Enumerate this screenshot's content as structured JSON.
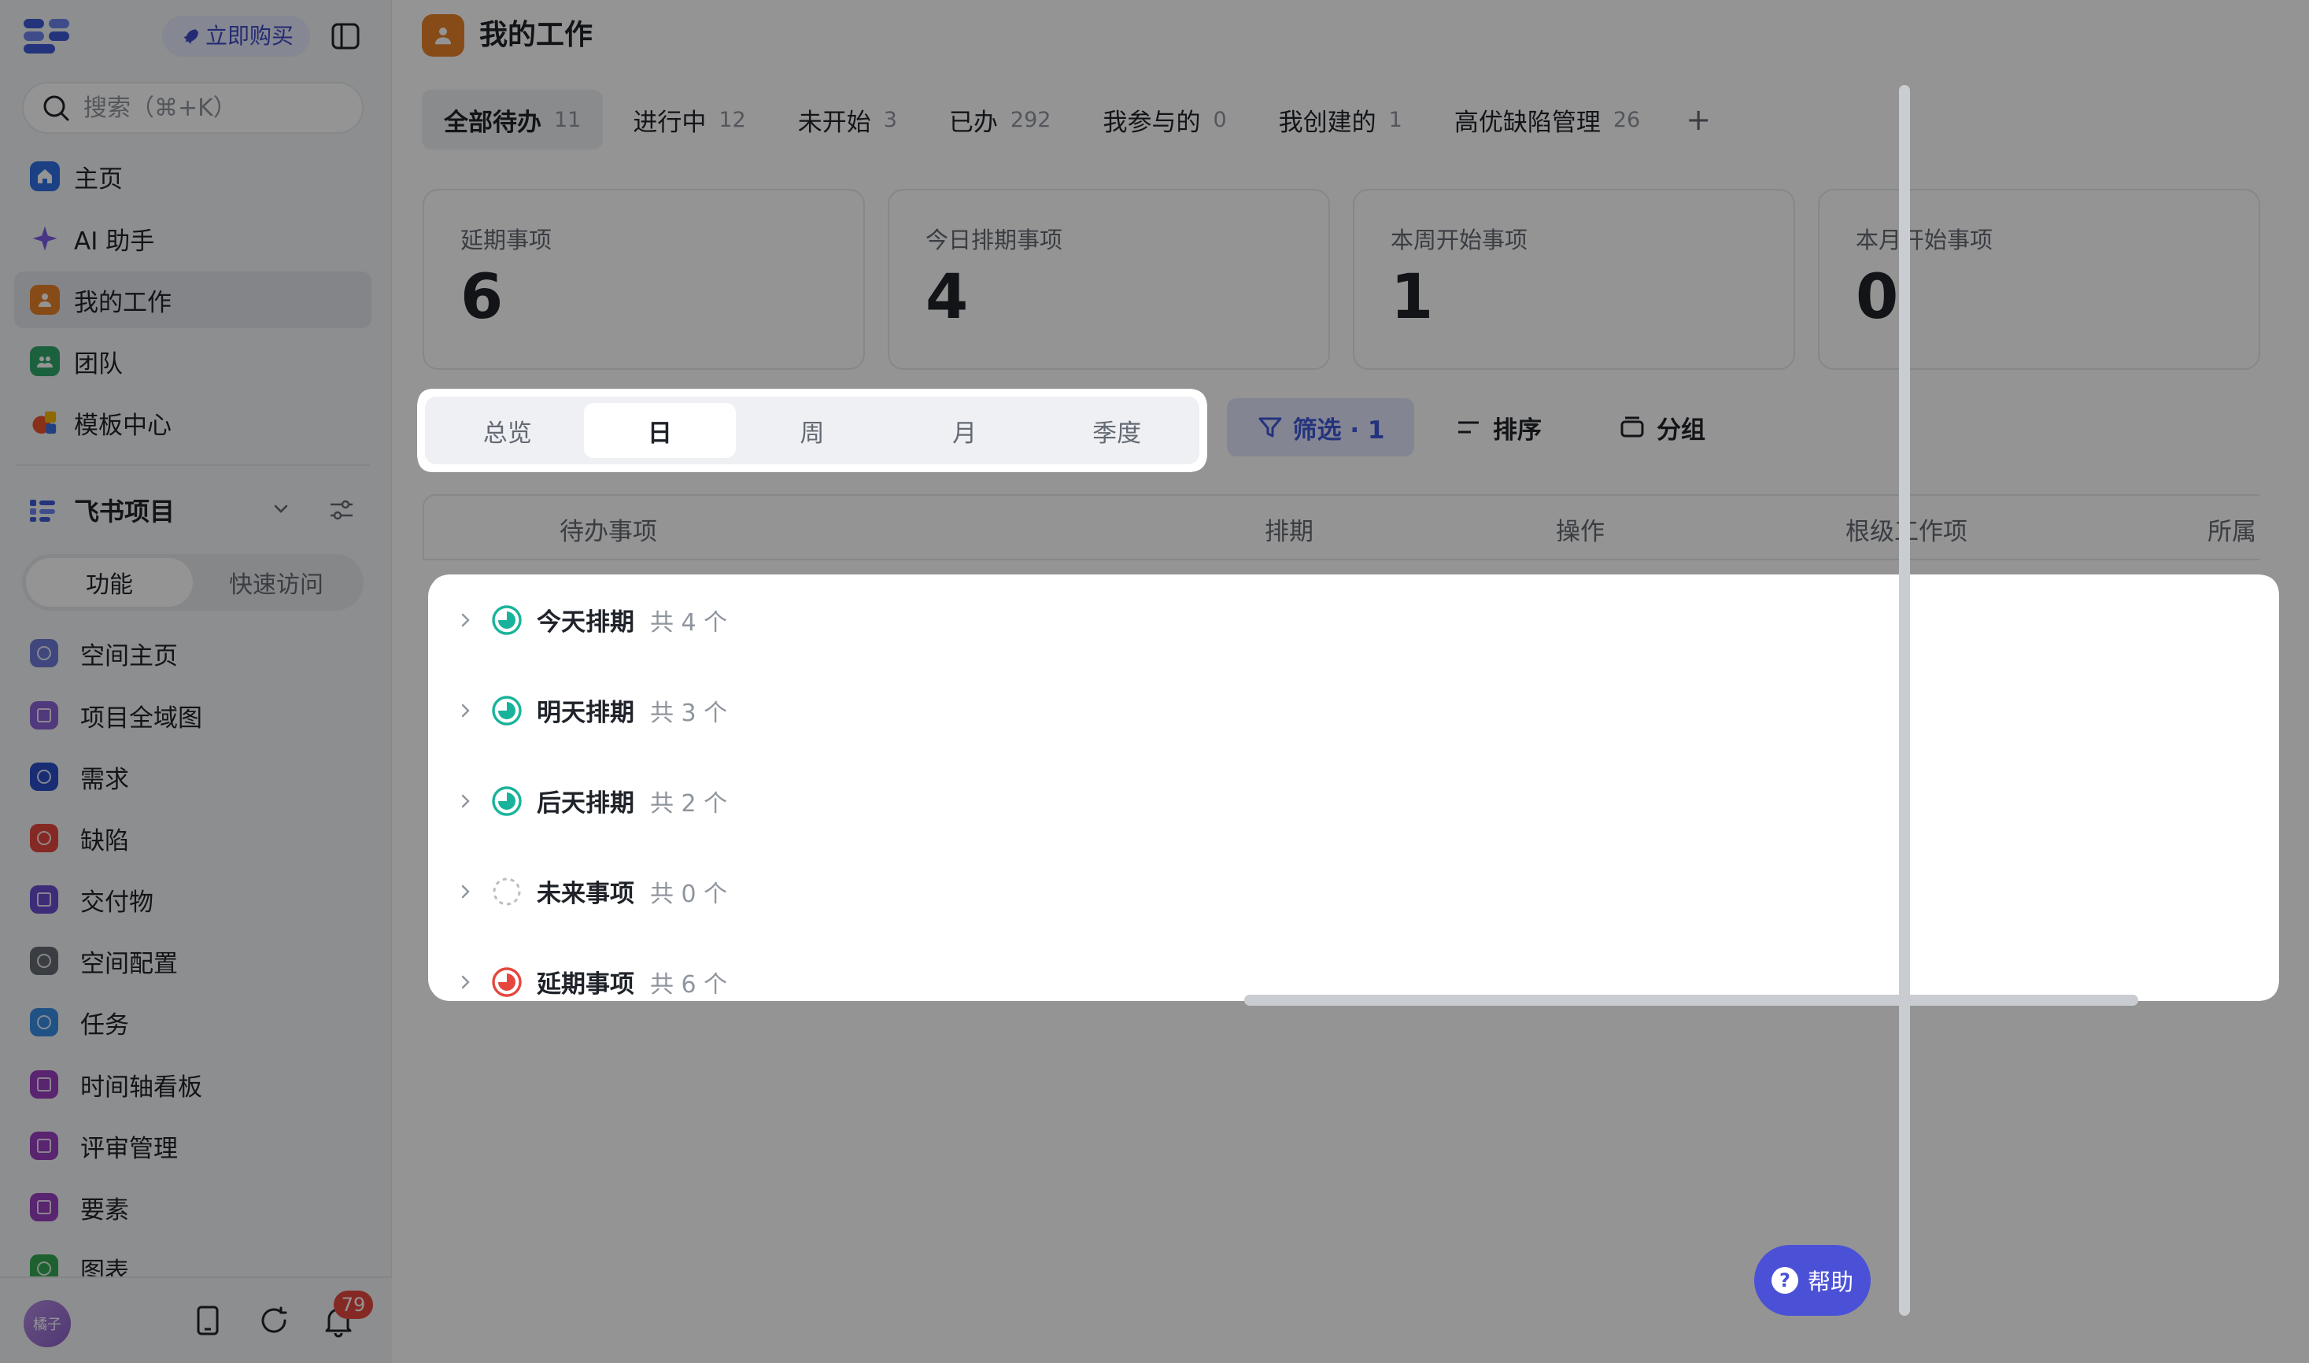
{
  "sidebar": {
    "buy_label": "立即购买",
    "search_placeholder": "搜索（⌘+K）",
    "nav": [
      {
        "label": "主页",
        "color": "#2f6fe4"
      },
      {
        "label": "AI 助手",
        "color": "#7b5ce6"
      },
      {
        "label": "我的工作",
        "color": "#e8822a"
      },
      {
        "label": "团队",
        "color": "#2fa76a"
      },
      {
        "label": "模板中心",
        "color": "#e9552f"
      }
    ],
    "project_title": "飞书项目",
    "segment": [
      "功能",
      "快速访问"
    ],
    "features": [
      {
        "label": "空间主页",
        "color": "#6e7bd9"
      },
      {
        "label": "项目全域图",
        "color": "#8a63d6"
      },
      {
        "label": "需求",
        "color": "#2a4fc9"
      },
      {
        "label": "缺陷",
        "color": "#e5473f"
      },
      {
        "label": "交付物",
        "color": "#6a4fd1"
      },
      {
        "label": "空间配置",
        "color": "#646a73"
      },
      {
        "label": "任务",
        "color": "#3a8ee6"
      },
      {
        "label": "时间轴看板",
        "color": "#9a3fc2"
      },
      {
        "label": "评审管理",
        "color": "#9a3fc2"
      },
      {
        "label": "要素",
        "color": "#9a3fc2"
      },
      {
        "label": "图表",
        "color": "#34a853"
      }
    ],
    "avatar_text": "橘子",
    "notification_count": "79"
  },
  "main": {
    "title": "我的工作",
    "tabs": [
      {
        "label": "全部待办",
        "count": "11"
      },
      {
        "label": "进行中",
        "count": "12"
      },
      {
        "label": "未开始",
        "count": "3"
      },
      {
        "label": "已办",
        "count": "292"
      },
      {
        "label": "我参与的",
        "count": "0"
      },
      {
        "label": "我创建的",
        "count": "1"
      },
      {
        "label": "高优缺陷管理",
        "count": "26"
      }
    ],
    "add_tab": "+",
    "cards": [
      {
        "label": "延期事项",
        "value": "6"
      },
      {
        "label": "今日排期事项",
        "value": "4"
      },
      {
        "label": "本周开始事项",
        "value": "1"
      },
      {
        "label": "本月开始事项",
        "value": "0"
      }
    ],
    "range": [
      "总览",
      "日",
      "周",
      "月",
      "季度"
    ],
    "filter_label": "筛选 · 1",
    "sort_label": "排序",
    "group_label": "分组",
    "columns": [
      "待办事项",
      "排期",
      "操作",
      "根级工作项",
      "所属"
    ],
    "groups": [
      {
        "title": "今天排期",
        "count": "共 4 个",
        "status": "scheduled"
      },
      {
        "title": "明天排期",
        "count": "共 3 个",
        "status": "scheduled"
      },
      {
        "title": "后天排期",
        "count": "共 2 个",
        "status": "scheduled"
      },
      {
        "title": "未来事项",
        "count": "共 0 个",
        "status": "empty"
      },
      {
        "title": "延期事项",
        "count": "共 6 个",
        "status": "overdue"
      }
    ],
    "help_label": "帮助",
    "colors": {
      "accent": "#3f58d8",
      "scheduled": "#19b39b",
      "overdue": "#e5473f"
    }
  }
}
